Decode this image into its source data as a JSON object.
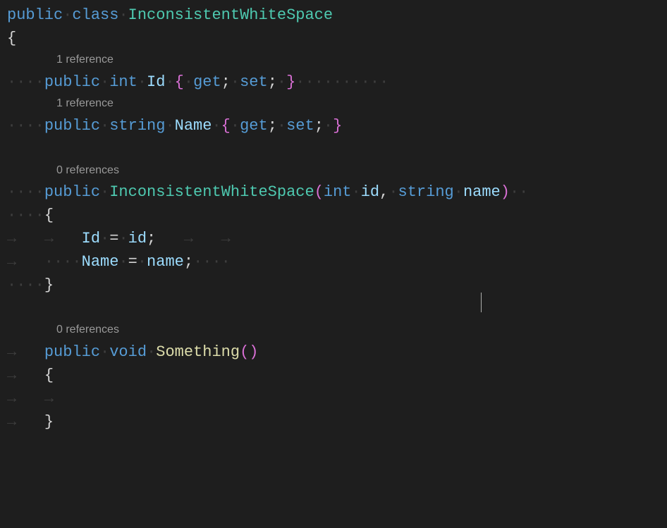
{
  "codelens": {
    "ref1a": "1 reference",
    "ref1b": "1 reference",
    "ref0a": "0 references",
    "ref0b": "0 references"
  },
  "code": {
    "kw_public": "public",
    "kw_class": "class",
    "kw_int": "int",
    "kw_string": "string",
    "kw_void": "void",
    "kw_get": "get",
    "kw_set": "set",
    "class_name": "InconsistentWhiteSpace",
    "prop_id": "Id",
    "prop_name": "Name",
    "param_id": "id",
    "param_name": "name",
    "method_something": "Something",
    "brace_open": "{",
    "brace_close": "}",
    "paren_open": "(",
    "paren_close": ")",
    "semi": ";",
    "comma": ",",
    "equals": "=",
    "dot": "·",
    "arrow": "→"
  }
}
